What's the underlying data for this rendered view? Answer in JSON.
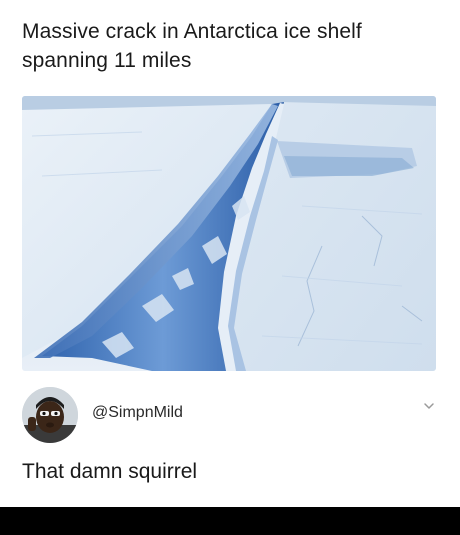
{
  "post": {
    "caption_line1": "Massive crack in Antarctica ice shelf",
    "caption_line2": "spanning 11 miles",
    "image_subject": "ice-shelf-crack-photo"
  },
  "comment": {
    "handle": "@SimpnMild",
    "text": "That damn squirrel",
    "avatar_icon": "user-avatar-icon",
    "expand_icon": "chevron-down-icon"
  },
  "colors": {
    "background": "#ffffff",
    "text": "#1a1a1a",
    "ice_light": "#dfeaf5",
    "ice_shadow": "#8fb0d6",
    "crack_blue": "#3b6fb8"
  }
}
